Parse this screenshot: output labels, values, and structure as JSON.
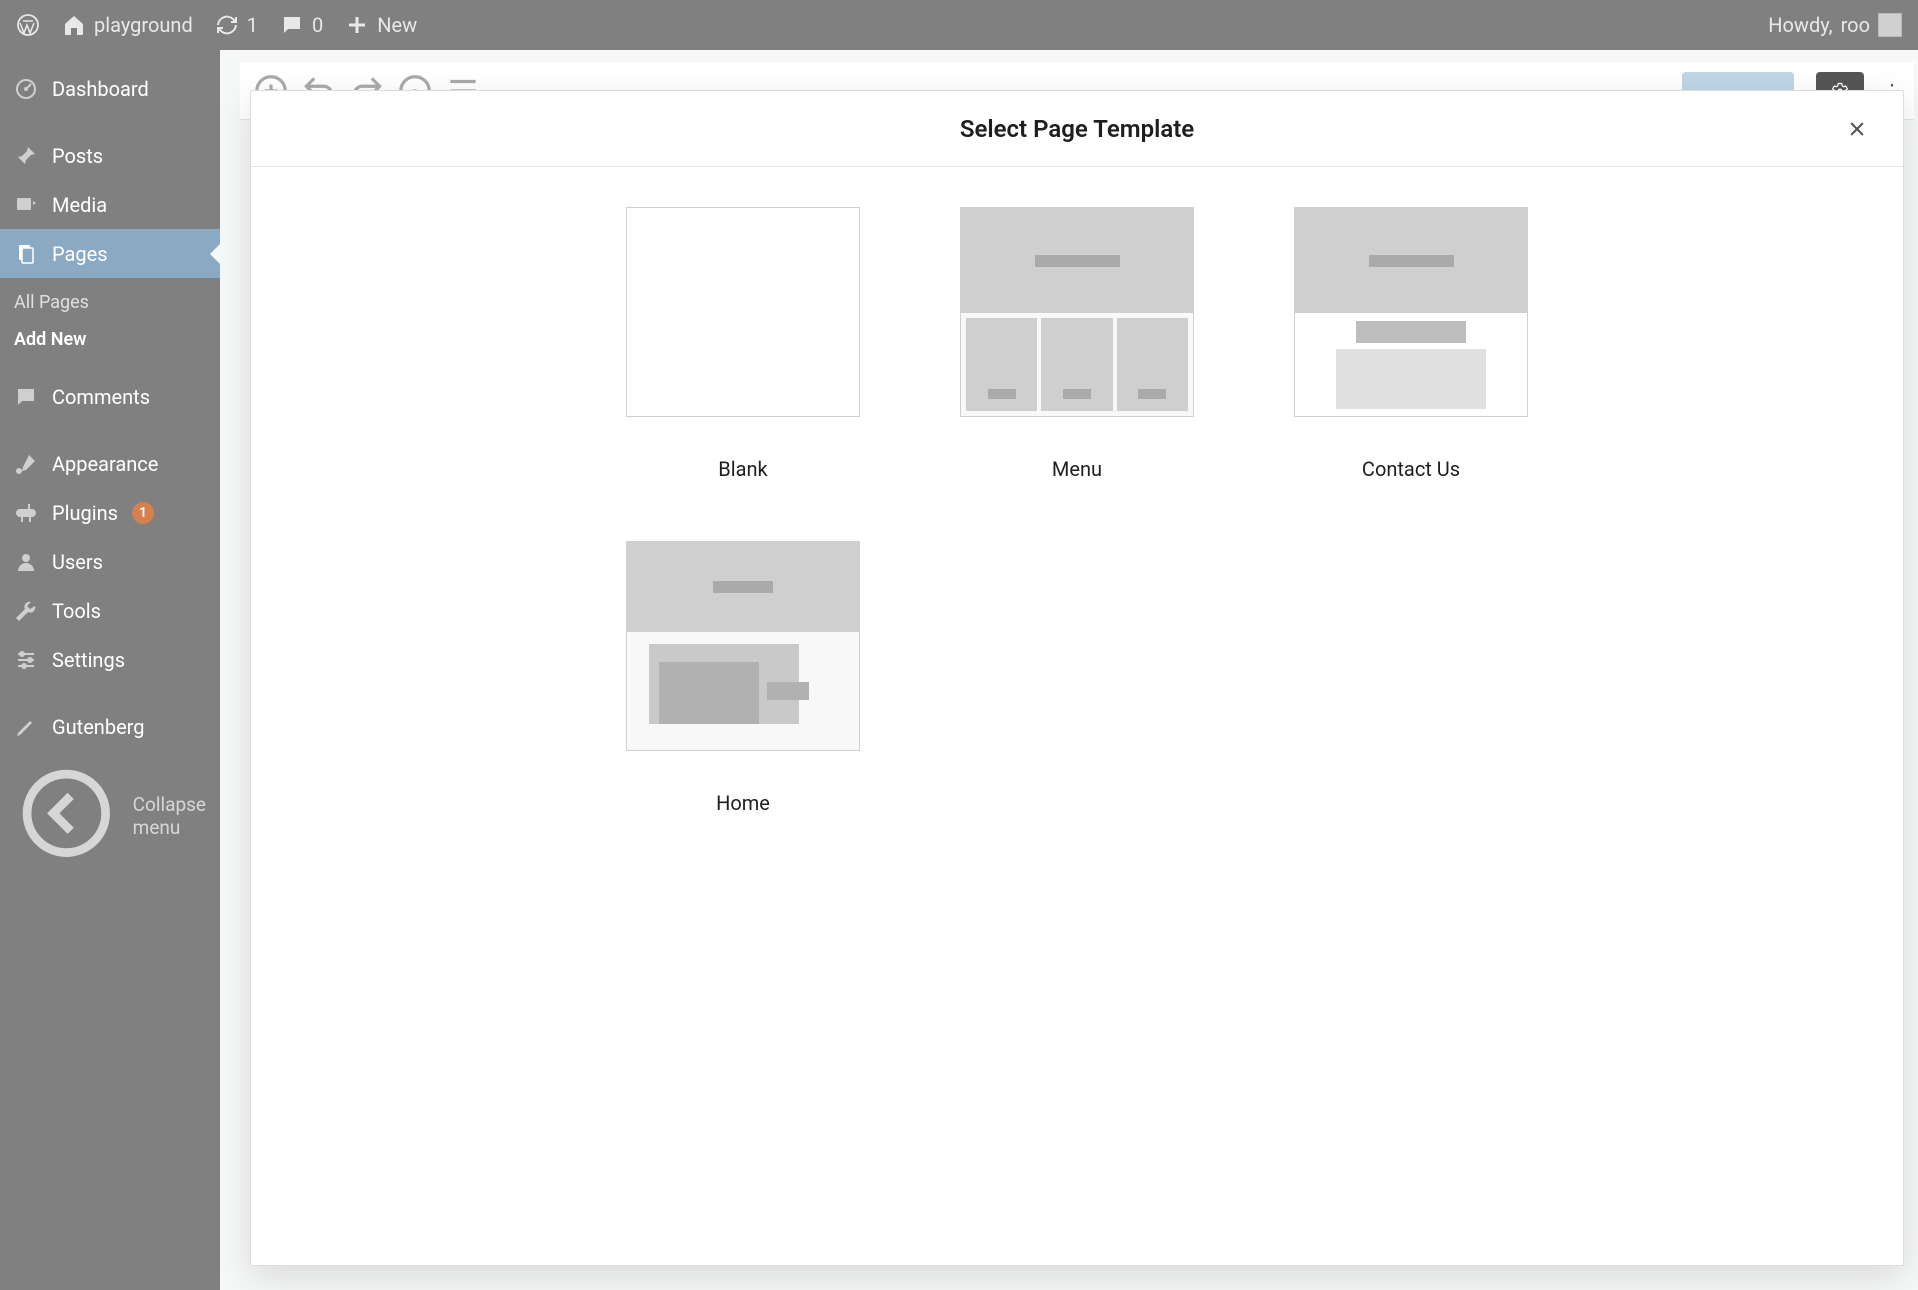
{
  "adminbar": {
    "site_name": "playground",
    "updates_count": "1",
    "comments_count": "0",
    "new_label": "New",
    "howdy_prefix": "Howdy,",
    "user_name": "roo"
  },
  "sidebar": {
    "items": [
      {
        "label": "Dashboard"
      },
      {
        "label": "Posts"
      },
      {
        "label": "Media"
      },
      {
        "label": "Pages"
      },
      {
        "label": "Comments"
      },
      {
        "label": "Appearance"
      },
      {
        "label": "Plugins"
      },
      {
        "label": "Users"
      },
      {
        "label": "Tools"
      },
      {
        "label": "Settings"
      },
      {
        "label": "Gutenberg"
      }
    ],
    "plugins_badge": "1",
    "sub": {
      "all_pages": "All Pages",
      "add_new": "Add New"
    },
    "collapse_label": "Collapse menu"
  },
  "modal": {
    "title": "Select Page Template",
    "templates": [
      {
        "name": "Blank"
      },
      {
        "name": "Menu"
      },
      {
        "name": "Contact Us"
      },
      {
        "name": "Home"
      }
    ]
  }
}
